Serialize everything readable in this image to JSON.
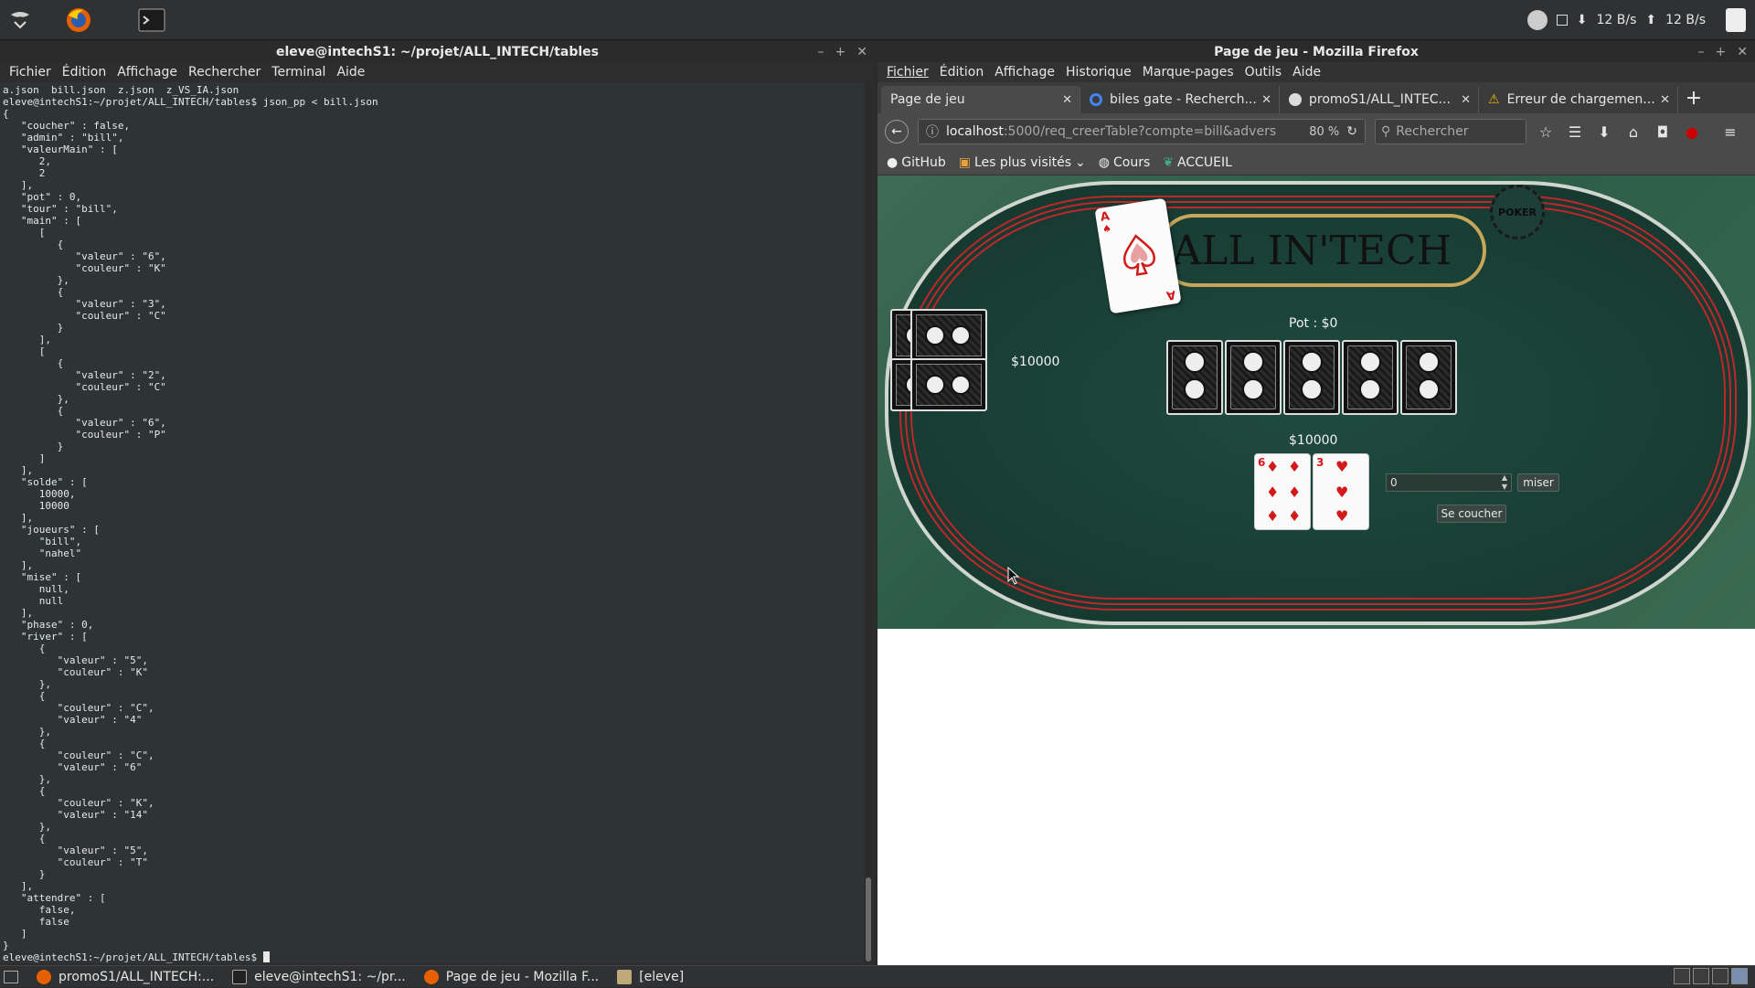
{
  "terminal": {
    "title": "eleve@intechS1: ~/projet/ALL_INTECH/tables",
    "menu": [
      "Fichier",
      "Édition",
      "Affichage",
      "Rechercher",
      "Terminal",
      "Aide"
    ],
    "lines": [
      "a.json  bill.json  z.json  z_VS_IA.json",
      "eleve@intechS1:~/projet/ALL_INTECH/tables$ json_pp < bill.json",
      "{",
      "   \"coucher\" : false,",
      "   \"admin\" : \"bill\",",
      "   \"valeurMain\" : [",
      "      2,",
      "      2",
      "   ],",
      "   \"pot\" : 0,",
      "   \"tour\" : \"bill\",",
      "   \"main\" : [",
      "      [",
      "         {",
      "            \"valeur\" : \"6\",",
      "            \"couleur\" : \"K\"",
      "         },",
      "         {",
      "            \"valeur\" : \"3\",",
      "            \"couleur\" : \"C\"",
      "         }",
      "      ],",
      "      [",
      "         {",
      "            \"valeur\" : \"2\",",
      "            \"couleur\" : \"C\"",
      "         },",
      "         {",
      "            \"valeur\" : \"6\",",
      "            \"couleur\" : \"P\"",
      "         }",
      "      ]",
      "   ],",
      "   \"solde\" : [",
      "      10000,",
      "      10000",
      "   ],",
      "   \"joueurs\" : [",
      "      \"bill\",",
      "      \"nahel\"",
      "   ],",
      "   \"mise\" : [",
      "      null,",
      "      null",
      "   ],",
      "   \"phase\" : 0,",
      "   \"river\" : [",
      "      {",
      "         \"valeur\" : \"5\",",
      "         \"couleur\" : \"K\"",
      "      },",
      "      {",
      "         \"couleur\" : \"C\",",
      "         \"valeur\" : \"4\"",
      "      },",
      "      {",
      "         \"couleur\" : \"C\",",
      "         \"valeur\" : \"6\"",
      "      },",
      "      {",
      "         \"couleur\" : \"K\",",
      "         \"valeur\" : \"14\"",
      "      },",
      "      {",
      "         \"valeur\" : \"5\",",
      "         \"couleur\" : \"T\"",
      "      }",
      "   ],",
      "   \"attendre\" : [",
      "      false,",
      "      false",
      "   ]",
      "}"
    ],
    "prompt": "eleve@intechS1:~/projet/ALL_INTECH/tables$ "
  },
  "firefox": {
    "title": "Page de jeu - Mozilla Firefox",
    "menu": [
      "Fichier",
      "Édition",
      "Affichage",
      "Historique",
      "Marque-pages",
      "Outils",
      "Aide"
    ],
    "tabs": [
      {
        "label": "Page de jeu"
      },
      {
        "label": "biles gate - Recherch..."
      },
      {
        "label": "promoS1/ALL_INTEC..."
      },
      {
        "label": "Erreur de chargemen..."
      }
    ],
    "new_tab": "+",
    "url_host": "localhost",
    "url_path": ":5000/req_creerTable?compte=bill&advers",
    "zoom": "80 %",
    "search_placeholder": "Rechercher",
    "bookmarks": [
      "GitHub",
      "Les plus visités",
      "Cours",
      "ACCUEIL"
    ]
  },
  "game": {
    "logo_text": "ALL IN'TECH",
    "chip_text": "POKER",
    "ace_rank": "A",
    "pot_label": "Pot : $0",
    "opponent_balance": "$10000",
    "player_balance": "$10000",
    "player_cards": [
      {
        "rank": "6",
        "suit": "♦"
      },
      {
        "rank": "3",
        "suit": "♥"
      }
    ],
    "bet_value": "0",
    "bet_button": "miser",
    "fold_button": "Se coucher"
  },
  "taskbar": {
    "tasks": [
      "promoS1/ALL_INTECH:...",
      "eleve@intechS1: ~/pr...",
      "Page de jeu - Mozilla F...",
      "[eleve]"
    ]
  },
  "panel": {
    "net_down": "12 B/s",
    "net_up": "12 B/s"
  },
  "colors": {
    "terminal_bg": "#2e3436",
    "felt": "#1f4b3f",
    "rail_red": "#c0262a",
    "suit_red": "#d21a1a",
    "logo_gold": "#c7a65a"
  }
}
